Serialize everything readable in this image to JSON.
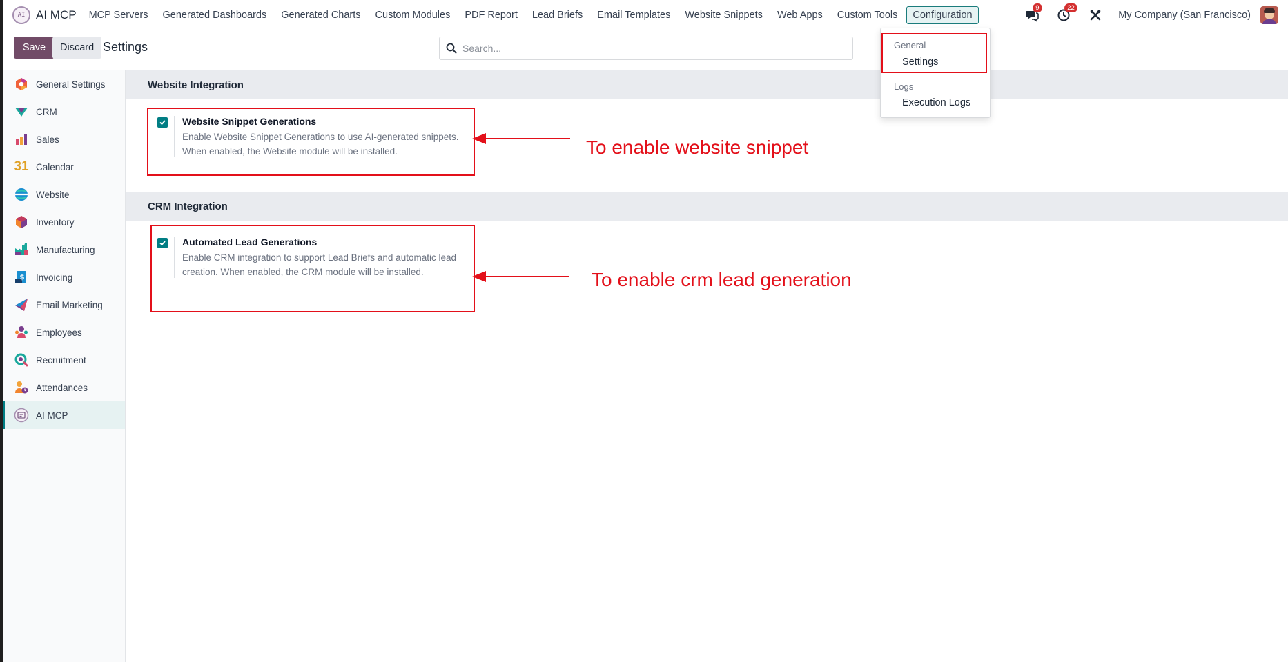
{
  "app": {
    "name": "AI MCP"
  },
  "nav": {
    "items": [
      "MCP Servers",
      "Generated Dashboards",
      "Generated Charts",
      "Custom Modules",
      "PDF Report",
      "Lead Briefs",
      "Email Templates",
      "Website Snippets",
      "Web Apps",
      "Custom Tools",
      "Configuration"
    ],
    "active": "Configuration",
    "messages_count": "9",
    "activities_count": "22",
    "company": "My Company (San Francisco)"
  },
  "control": {
    "save_label": "Save",
    "discard_label": "Discard",
    "title": "Settings",
    "search_placeholder": "Search..."
  },
  "sidebar": {
    "items": [
      {
        "label": "General Settings",
        "icon": "general-settings-icon"
      },
      {
        "label": "CRM",
        "icon": "crm-icon"
      },
      {
        "label": "Sales",
        "icon": "sales-icon"
      },
      {
        "label": "Calendar",
        "icon": "calendar-icon"
      },
      {
        "label": "Website",
        "icon": "website-icon"
      },
      {
        "label": "Inventory",
        "icon": "inventory-icon"
      },
      {
        "label": "Manufacturing",
        "icon": "manufacturing-icon"
      },
      {
        "label": "Invoicing",
        "icon": "invoicing-icon"
      },
      {
        "label": "Email Marketing",
        "icon": "email-marketing-icon"
      },
      {
        "label": "Employees",
        "icon": "employees-icon"
      },
      {
        "label": "Recruitment",
        "icon": "recruitment-icon"
      },
      {
        "label": "Attendances",
        "icon": "attendances-icon"
      },
      {
        "label": "AI MCP",
        "icon": "ai-mcp-icon"
      }
    ],
    "calendar_day": "31",
    "active": "AI MCP"
  },
  "sections": {
    "website": {
      "title": "Website Integration",
      "setting_title": "Website Snippet Generations",
      "setting_desc": "Enable Website Snippet Generations to use AI-generated snippets. When enabled, the Website module will be installed.",
      "checked": true
    },
    "crm": {
      "title": "CRM Integration",
      "setting_title": "Automated Lead Generations",
      "setting_desc": "Enable CRM integration to support Lead Briefs and automatic lead creation. When enabled, the CRM module will be installed.",
      "checked": true
    }
  },
  "annotations": {
    "website": "To enable website snippet",
    "crm": "To enable crm lead generation"
  },
  "dropdown": {
    "general_header": "General",
    "settings_item": "Settings",
    "logs_header": "Logs",
    "execution_logs_item": "Execution Logs"
  },
  "colors": {
    "primary": "#714b67",
    "accent": "#017e84",
    "annotation": "#e3101a"
  }
}
